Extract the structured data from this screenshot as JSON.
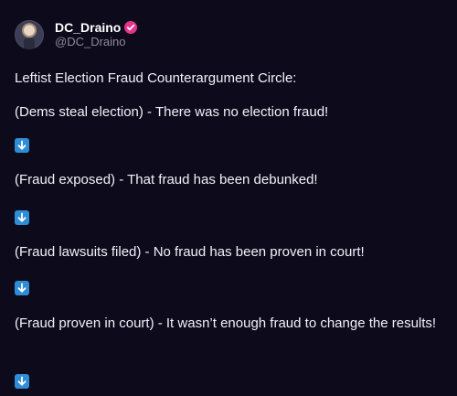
{
  "author": {
    "display_name": "DC_Draino",
    "handle": "@DC_Draino",
    "verified_icon": "verified-badge-icon",
    "verified_color": "#e8338b"
  },
  "post": {
    "lines": [
      "Leftist Election Fraud Counterargument Circle:",
      "(Dems steal election) - There was no election fraud!",
      "(Fraud exposed) - That fraud has been debunked!",
      "(Fraud lawsuits filed) - No fraud has been proven in court!",
      "(Fraud proven in court) - It wasn’t enough fraud to change the results!"
    ],
    "arrow_icon": "down-arrow-emoji-icon",
    "arrow_color": "#2f8dd6"
  },
  "colors": {
    "background": "#0d0a1c",
    "text": "#f3f1f7",
    "handle": "#8e8a9e"
  }
}
